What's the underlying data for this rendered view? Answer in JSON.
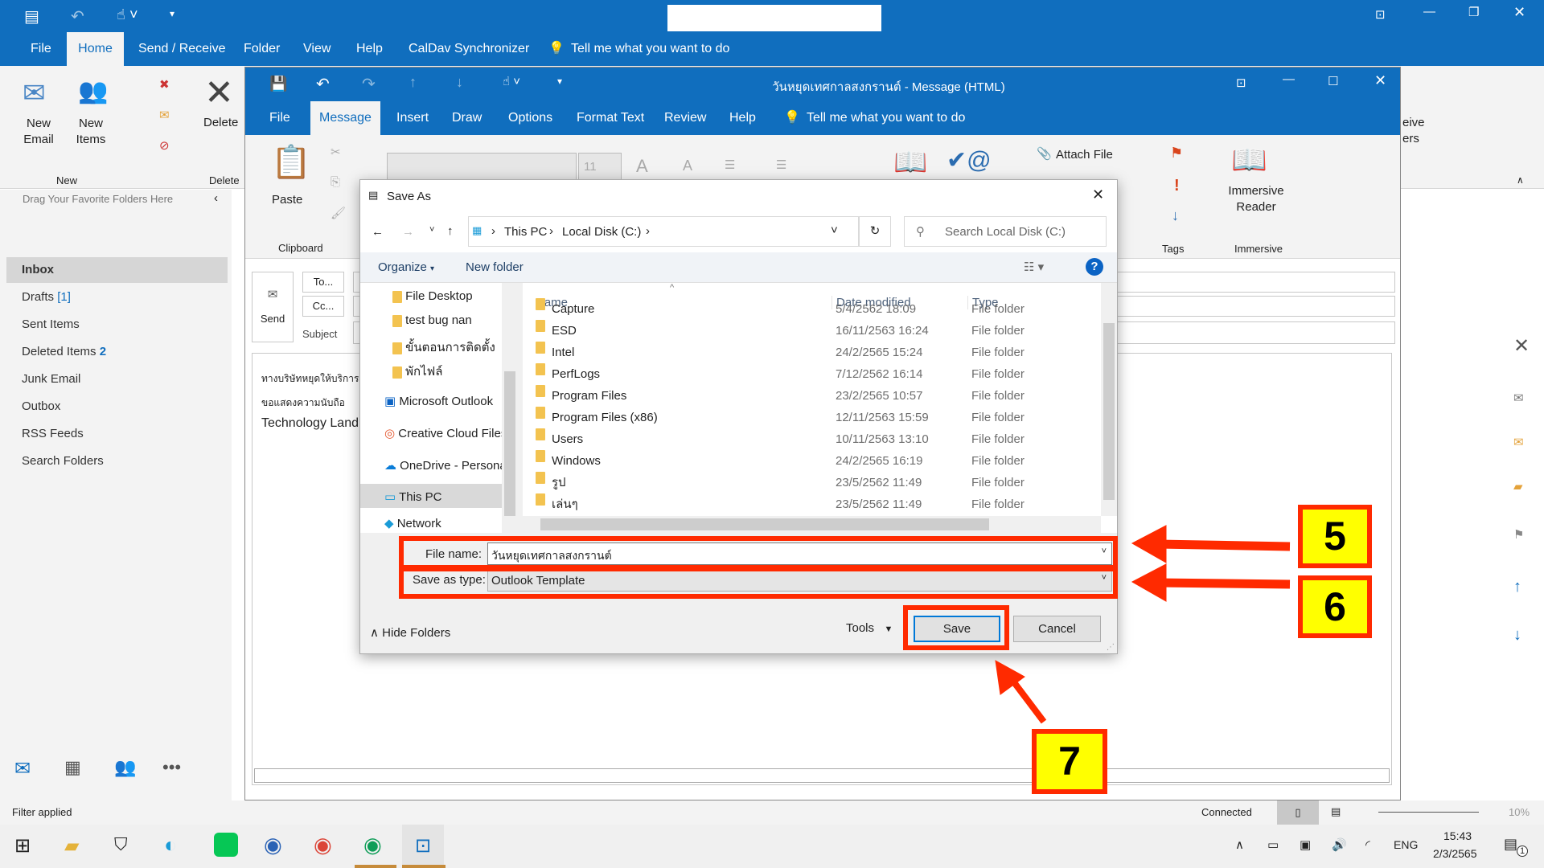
{
  "outlook": {
    "quick_access": [
      "save-icon",
      "undo-icon",
      "touch-mode-icon",
      "customize-icon"
    ],
    "tabs": [
      "File",
      "Home",
      "Send / Receive",
      "Folder",
      "View",
      "Help",
      "CalDav Synchronizer"
    ],
    "tell_me": "Tell me what you want to do",
    "ribbon": {
      "new_email": "New Email",
      "new_items": "New Items",
      "group_new": "New",
      "delete": "Delete",
      "group_delete": "Delete",
      "receive_fragment": "eive",
      "ers_fragment": "ers"
    },
    "favorites_hint": "Drag Your Favorite Folders Here",
    "folders": [
      {
        "label": "Inbox",
        "count": ""
      },
      {
        "label": "Drafts",
        "count": "[1]"
      },
      {
        "label": "Sent Items",
        "count": ""
      },
      {
        "label": "Deleted Items",
        "count": "2"
      },
      {
        "label": "Junk Email",
        "count": ""
      },
      {
        "label": "Outbox",
        "count": ""
      },
      {
        "label": "RSS Feeds",
        "count": ""
      },
      {
        "label": "Search Folders",
        "count": ""
      }
    ],
    "status_left": "Filter applied",
    "status_connected": "Connected",
    "zoom": "10%"
  },
  "message": {
    "title": "วันหยุดเทศกาลสงกรานต์  -  Message (HTML)",
    "tabs": [
      "File",
      "Message",
      "Insert",
      "Draw",
      "Options",
      "Format Text",
      "Review",
      "Help"
    ],
    "tell_me": "Tell me what you want to do",
    "paste": "Paste",
    "clipboard": "Clipboard",
    "font_size": "11",
    "attach_file": "Attach File",
    "tags": "Tags",
    "immersive_reader": "Immersive Reader",
    "immersive": "Immersive",
    "send": "Send",
    "to": "To...",
    "cc": "Cc...",
    "subject": "Subject",
    "body": [
      "ทางบริษัทหยุดให้บริการเ",
      "ขอแสดงความนับถือ",
      "Technology Land"
    ]
  },
  "dialog": {
    "title": "Save As",
    "breadcrumb": [
      "This PC",
      "Local Disk (C:)"
    ],
    "search_placeholder": "Search Local Disk (C:)",
    "organize": "Organize",
    "new_folder": "New folder",
    "nav": [
      "File Desktop",
      "test bug nan",
      "ขั้นตอนการติดตั้ง",
      "พักไฟล์",
      "Microsoft Outlook",
      "Creative Cloud Files",
      "OneDrive - Personal",
      "This PC",
      "Network"
    ],
    "columns": [
      "Name",
      "Date modified",
      "Type"
    ],
    "files": [
      {
        "name": "Capture",
        "date": "5/4/2562 18:09",
        "type": "File folder"
      },
      {
        "name": "ESD",
        "date": "16/11/2563 16:24",
        "type": "File folder"
      },
      {
        "name": "Intel",
        "date": "24/2/2565 15:24",
        "type": "File folder"
      },
      {
        "name": "PerfLogs",
        "date": "7/12/2562 16:14",
        "type": "File folder"
      },
      {
        "name": "Program Files",
        "date": "23/2/2565 10:57",
        "type": "File folder"
      },
      {
        "name": "Program Files (x86)",
        "date": "12/11/2563 15:59",
        "type": "File folder"
      },
      {
        "name": "Users",
        "date": "10/11/2563 13:10",
        "type": "File folder"
      },
      {
        "name": "Windows",
        "date": "24/2/2565 16:19",
        "type": "File folder"
      },
      {
        "name": "รูป",
        "date": "23/5/2562 11:49",
        "type": "File folder"
      },
      {
        "name": "เล่นๆ",
        "date": "23/5/2562 11:49",
        "type": "File folder"
      }
    ],
    "file_name_label": "File name:",
    "file_name": "วันหยุดเทศกาลสงกรานต์",
    "save_type_label": "Save as type:",
    "save_type": "Outlook Template",
    "hide_folders": "Hide Folders",
    "tools": "Tools",
    "save": "Save",
    "cancel": "Cancel"
  },
  "annotations": {
    "step5": "5",
    "step6": "6",
    "step7": "7",
    "color": "#ff2a00",
    "box_color": "#ffff00"
  },
  "taskbar": {
    "apps": [
      "windows-start",
      "file-explorer",
      "security",
      "edge",
      "line",
      "thunderbird",
      "chrome",
      "chrome-profile",
      "outlook"
    ],
    "lang": "ENG",
    "time": "15:43",
    "date": "2/3/2565",
    "notifications": "1"
  }
}
